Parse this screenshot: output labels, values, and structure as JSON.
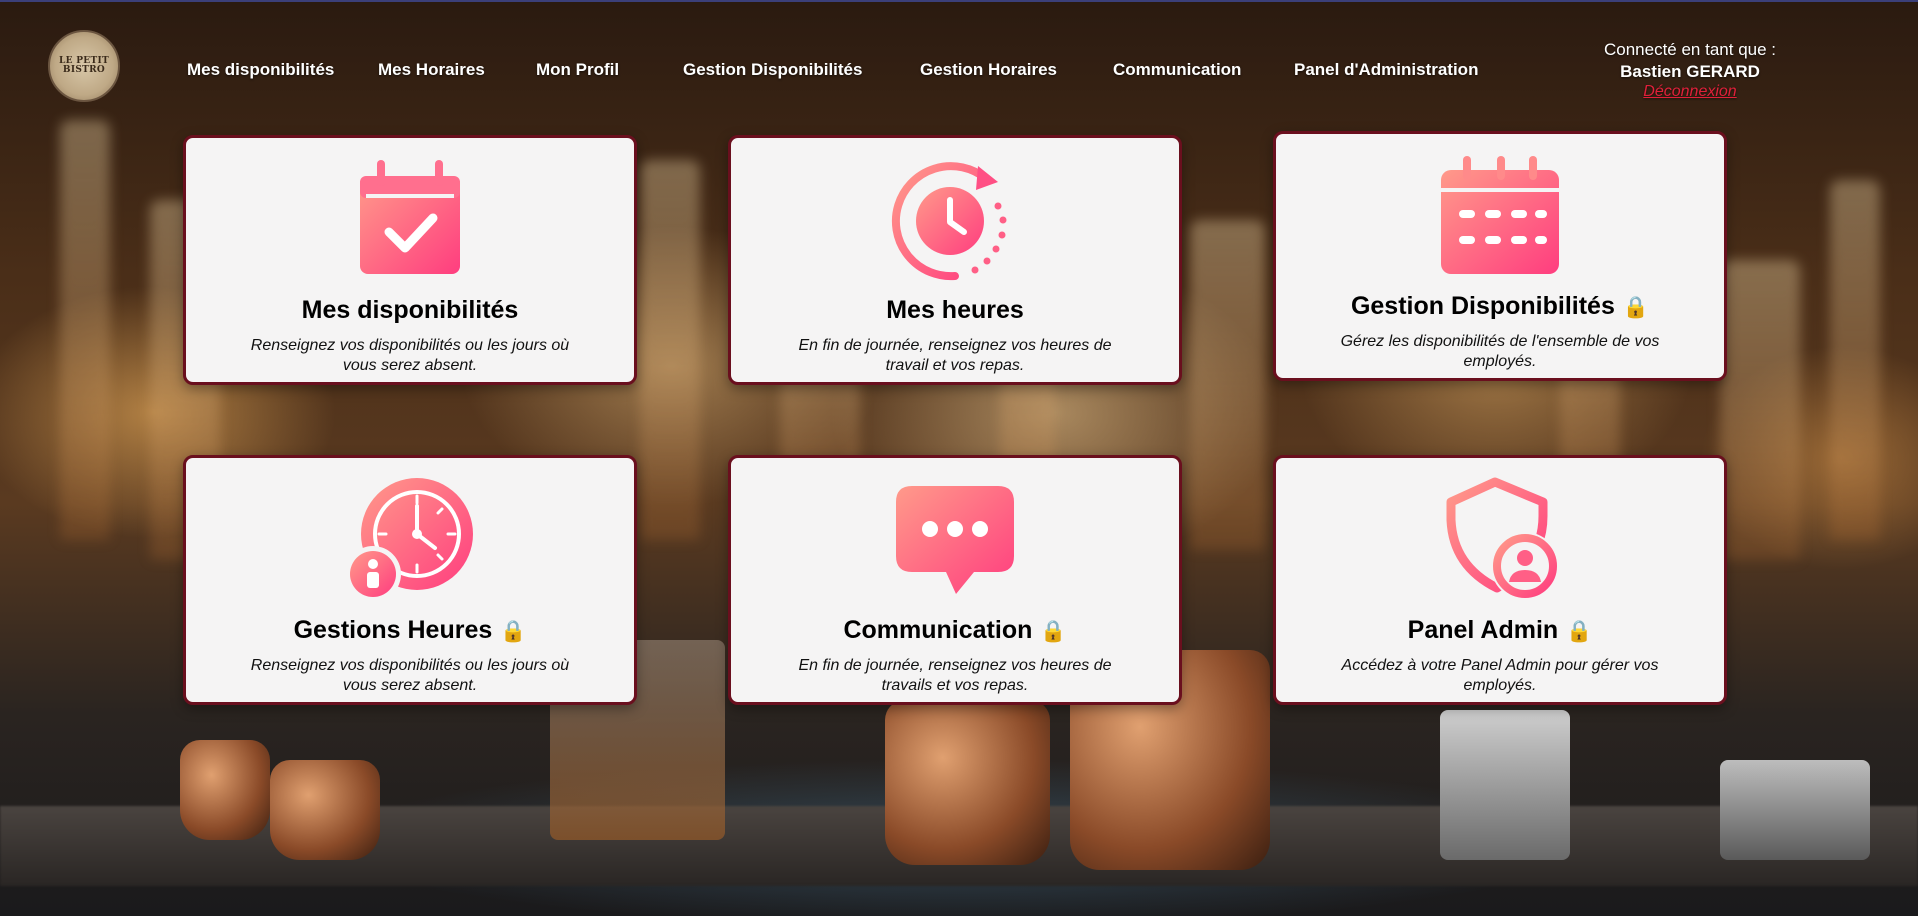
{
  "nav": {
    "logo_text": "LE PETIT BISTRO",
    "items": [
      {
        "label": "Mes disponibilités"
      },
      {
        "label": "Mes Horaires"
      },
      {
        "label": "Mon Profil"
      },
      {
        "label": "Gestion Disponibilités"
      },
      {
        "label": "Gestion Horaires"
      },
      {
        "label": "Communication"
      },
      {
        "label": "Panel d'Administration"
      }
    ]
  },
  "user": {
    "connected_label": "Connecté en tant que :",
    "name": "Bastien GERARD",
    "logout_label": "Déconnexion"
  },
  "cards": [
    {
      "title": "Mes disponibilités",
      "description": "Renseignez vos disponibilités ou les jours où vous serez absent.",
      "icon": "calendar-check-icon",
      "locked": false
    },
    {
      "title": "Mes heures",
      "description": "En fin de journée, renseignez vos heures de travail et vos repas.",
      "icon": "clock-history-icon",
      "locked": false
    },
    {
      "title": "Gestion Disponibilités",
      "description": "Gérez les disponibilités de l'ensemble de vos employés.",
      "icon": "calendar-grid-icon",
      "locked": true
    },
    {
      "title": "Gestions Heures",
      "description": "Renseignez vos disponibilités ou les jours où vous serez absent.",
      "icon": "clock-user-icon",
      "locked": true
    },
    {
      "title": "Communication",
      "description": "En fin de journée, renseignez vos heures de travails et vos repas.",
      "icon": "chat-bubble-icon",
      "locked": true
    },
    {
      "title": "Panel Admin",
      "description": "Accédez à votre Panel Admin pour gérer vos employés.",
      "icon": "shield-user-icon",
      "locked": true
    }
  ],
  "colors": {
    "accent_light": "#ff8a8a",
    "accent_dark": "#ff3d7f",
    "card_border": "#6a0f1e",
    "logout": "#e0203a"
  },
  "lock_glyph": "🔒"
}
